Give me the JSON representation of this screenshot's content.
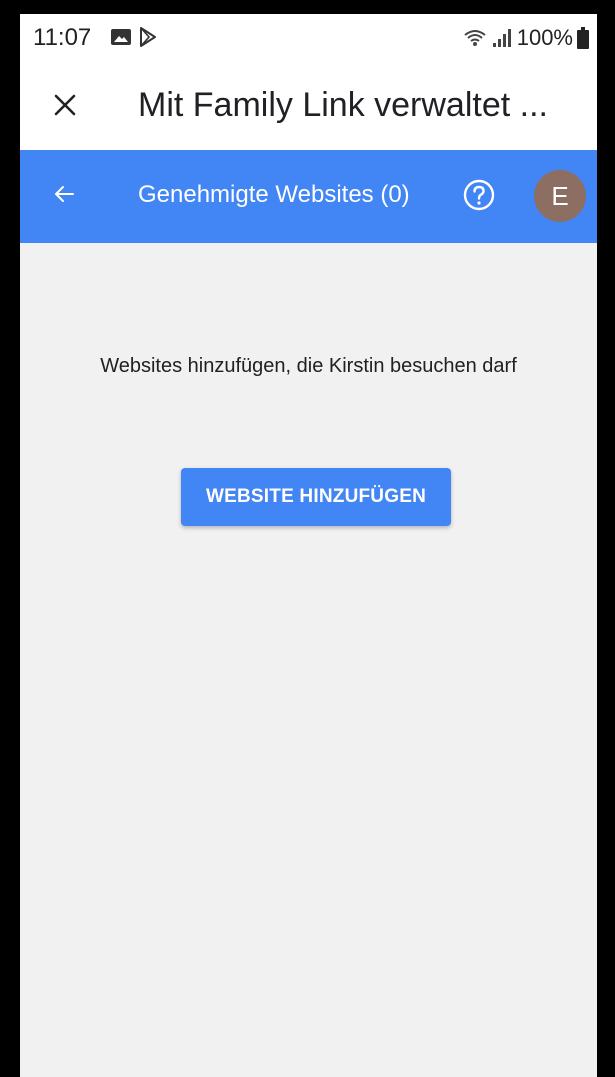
{
  "status_bar": {
    "time": "11:07",
    "battery": "100%",
    "icons": [
      "gallery-icon",
      "play-store-icon",
      "wifi-icon",
      "signal-icon",
      "battery-icon"
    ]
  },
  "title_bar": {
    "title": "Mit Family Link verwaltet ...",
    "close_icon": "close-icon"
  },
  "app_bar": {
    "title": "Genehmigte Websites (0)",
    "back_icon": "arrow-back-icon",
    "help_icon": "help-icon",
    "avatar_letter": "E",
    "color": "#4285f4",
    "avatar_color": "#8d6e63"
  },
  "content": {
    "message": "Websites hinzufügen, die Kirstin besuchen darf",
    "add_button_label": "WEBSITE HINZUFÜGEN"
  }
}
